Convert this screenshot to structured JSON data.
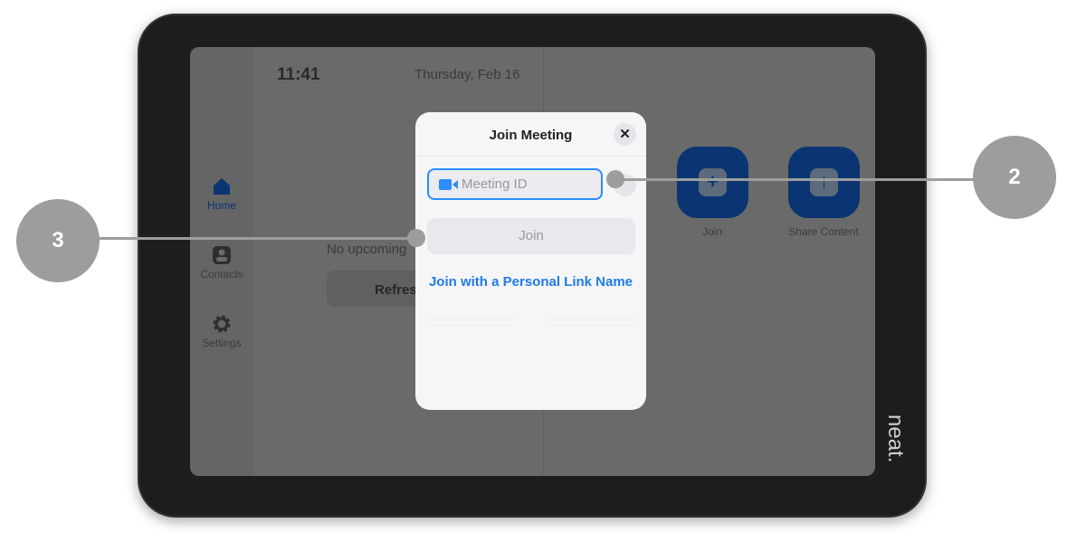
{
  "status": {
    "time": "11:41",
    "date": "Thursday, Feb 16"
  },
  "sidebar": {
    "items": [
      {
        "label": "Home",
        "icon": "home-icon",
        "active": true
      },
      {
        "label": "Contacts",
        "icon": "contact-icon"
      },
      {
        "label": "Settings",
        "icon": "gear-icon"
      }
    ]
  },
  "meetings": {
    "empty_text": "No upcoming",
    "refresh_label": "Refres"
  },
  "tiles": [
    {
      "label": "Join",
      "icon": "plus-icon"
    },
    {
      "label": "Share Content",
      "icon": "arrow-up-icon"
    }
  ],
  "brand": "neat.",
  "modal": {
    "title": "Join Meeting",
    "close": "✕",
    "meeting_id_placeholder": "Meeting ID",
    "join_label": "Join",
    "personal_link": "Join with a Personal Link Name"
  },
  "callouts": [
    "2",
    "3"
  ],
  "colors": {
    "accent": "#2d8cff",
    "tile": "#0a3572",
    "callout": "#9d9d9d"
  }
}
